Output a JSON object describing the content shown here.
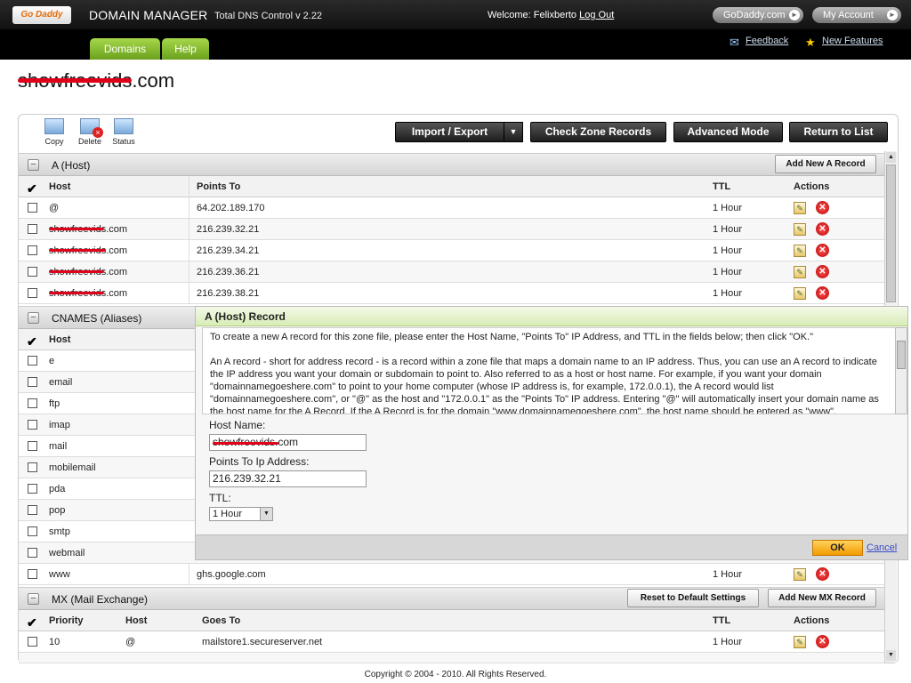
{
  "header": {
    "logo_text": "Go Daddy",
    "app_title": "DOMAIN MANAGER",
    "app_subtitle": "Total DNS Control v 2.22",
    "welcome": "Welcome: Felixberto",
    "logout": "Log Out",
    "godaddy_btn": "GoDaddy.com",
    "account_btn": "My Account"
  },
  "nav": {
    "tabs": [
      "Domains",
      "Help"
    ],
    "feedback": "Feedback",
    "new_features": "New Features"
  },
  "domain": {
    "name": "showfreevids.com"
  },
  "toolbar": {
    "tools": [
      "Copy",
      "Delete",
      "Status"
    ],
    "import_export": "Import / Export",
    "check_zone": "Check Zone Records",
    "advanced": "Advanced Mode",
    "return": "Return to List"
  },
  "a_host": {
    "title": "A (Host)",
    "add_btn": "Add New A Record",
    "columns": [
      "Host",
      "Points To",
      "TTL",
      "Actions"
    ],
    "rows": [
      {
        "host": "@",
        "points": "64.202.189.170",
        "ttl": "1 Hour"
      },
      {
        "host": "showfreevids.com",
        "points": "216.239.32.21",
        "ttl": "1 Hour"
      },
      {
        "host": "showfreevids.com",
        "points": "216.239.34.21",
        "ttl": "1 Hour"
      },
      {
        "host": "showfreevids.com",
        "points": "216.239.36.21",
        "ttl": "1 Hour"
      },
      {
        "host": "showfreevids.com",
        "points": "216.239.38.21",
        "ttl": "1 Hour"
      }
    ]
  },
  "cnames": {
    "title": "CNAMES (Aliases)",
    "columns": [
      "Host"
    ],
    "rows": [
      "e",
      "email",
      "ftp",
      "imap",
      "mail",
      "mobilemail",
      "pda",
      "pop",
      "smtp",
      "webmail"
    ],
    "www_row": {
      "host": "www",
      "points": "ghs.google.com",
      "ttl": "1 Hour"
    }
  },
  "mx": {
    "title": "MX (Mail Exchange)",
    "reset_btn": "Reset to Default Settings",
    "add_btn": "Add New MX Record",
    "columns": [
      "Priority",
      "Host",
      "Goes To",
      "TTL",
      "Actions"
    ],
    "rows": [
      {
        "priority": "10",
        "host": "@",
        "goes": "mailstore1.secureserver.net",
        "ttl": "1 Hour"
      }
    ]
  },
  "popup": {
    "title": "A (Host) Record",
    "para1": "To create a new A record for this zone file, please enter the Host Name, \"Points To\" IP Address, and TTL in the fields below; then click \"OK.\"",
    "para2": "An A record - short for address record - is a record within a zone file that maps a domain name to an IP address. Thus, you can use an A record to indicate the IP address you want your domain or subdomain to point to. Also referred to as a host or host name. For example, if you want your domain \"domainnamegoeshere.com\" to point to your home computer (whose IP address is, for example, 172.0.0.1), the A record would list \"domainnamegoeshere.com\", or \"@\" as the host and \"172.0.0.1\" as the \"Points To\" IP address. Entering \"@\" will automatically insert your domain name as the host name for the A Record. If the A Record is for the domain \"www.domainnamegoeshere.com\", the host name should be entered as \"www\".",
    "host_label": "Host Name:",
    "host_value": "showfreevids.com",
    "ip_label": "Points To Ip Address:",
    "ip_value": "216.239.32.21",
    "ttl_label": "TTL:",
    "ttl_value": "1 Hour",
    "ok": "OK",
    "cancel": "Cancel"
  },
  "footer": {
    "copyright": "Copyright © 2004 - 2010. All Rights Reserved."
  }
}
